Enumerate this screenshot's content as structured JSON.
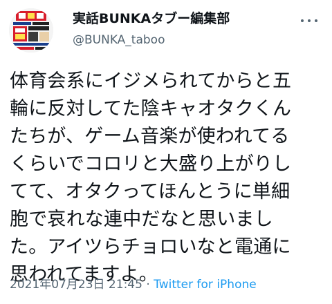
{
  "tweet": {
    "author": {
      "display_name": "実話BUNKAタブー編集部",
      "handle": "@BUNKA_taboo",
      "avatar": "magazine-cover-avatar"
    },
    "more_icon": "more-horizontal-icon",
    "body_lines": [
      "体育会系にイジメられてからと五",
      "輪に反対してた陰キャオタクくん",
      "たちが、ゲーム音楽が使われてる",
      "くらいでコロリと大盛り上がりし",
      "てて、オタクってほんとうに単細",
      "胞で哀れな連中だなと思いまし",
      "た。アイツらチョロいなと電通に",
      "思われてますよ。"
    ],
    "timestamp": "2021年07月23日 21:45",
    "separator": " · ",
    "source": "Twitter for iPhone",
    "colors": {
      "text": "#0f1419",
      "secondary": "#536471",
      "link": "#1d9bf0"
    }
  }
}
